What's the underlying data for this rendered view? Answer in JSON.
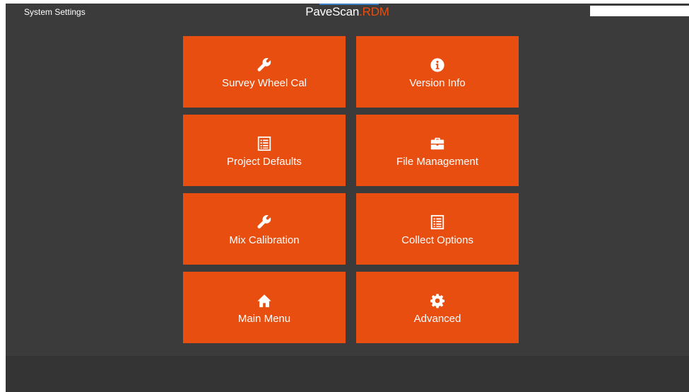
{
  "header": {
    "page_title": "System Settings",
    "brand_main": "PaveScan",
    "brand_accent": ".RDM",
    "search_value": ""
  },
  "colors": {
    "tile": "#e84e10",
    "background": "#3a3b3a",
    "brand_accent": "#e84e10"
  },
  "tiles": [
    {
      "label": "Survey Wheel Cal",
      "icon": "wrench-icon"
    },
    {
      "label": "Version Info",
      "icon": "info-icon"
    },
    {
      "label": "Project Defaults",
      "icon": "list-icon"
    },
    {
      "label": "File Management",
      "icon": "briefcase-icon"
    },
    {
      "label": "Mix Calibration",
      "icon": "wrench-icon"
    },
    {
      "label": "Collect Options",
      "icon": "list-icon"
    },
    {
      "label": "Main Menu",
      "icon": "home-icon"
    },
    {
      "label": "Advanced",
      "icon": "gear-icon"
    }
  ]
}
